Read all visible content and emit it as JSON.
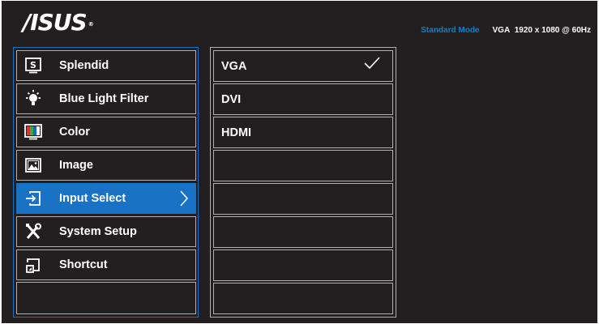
{
  "brand": {
    "name": "/ISUS",
    "trademark": "®"
  },
  "status": {
    "mode": "Standard Mode",
    "input": "VGA",
    "resolution": "1920 x 1080 @ 60Hz"
  },
  "menu": {
    "items": [
      {
        "label": "Splendid",
        "icon": "splendid-s-icon"
      },
      {
        "label": "Blue Light Filter",
        "icon": "light-bulb-icon"
      },
      {
        "label": "Color",
        "icon": "color-bars-icon"
      },
      {
        "label": "Image",
        "icon": "image-picture-icon"
      },
      {
        "label": "Input Select",
        "icon": "input-arrow-icon",
        "selected": true
      },
      {
        "label": "System Setup",
        "icon": "wrench-screwdriver-icon"
      },
      {
        "label": "Shortcut",
        "icon": "shortcut-icon"
      }
    ]
  },
  "submenu": {
    "items": [
      {
        "label": "VGA",
        "checked": true
      },
      {
        "label": "DVI"
      },
      {
        "label": "HDMI"
      },
      {
        "label": ""
      },
      {
        "label": ""
      },
      {
        "label": ""
      },
      {
        "label": ""
      },
      {
        "label": ""
      }
    ]
  },
  "colors": {
    "background": "#231f20",
    "accent": "#1a72c4",
    "mode_text": "#0a82c9",
    "border": "#b0b0b0"
  }
}
